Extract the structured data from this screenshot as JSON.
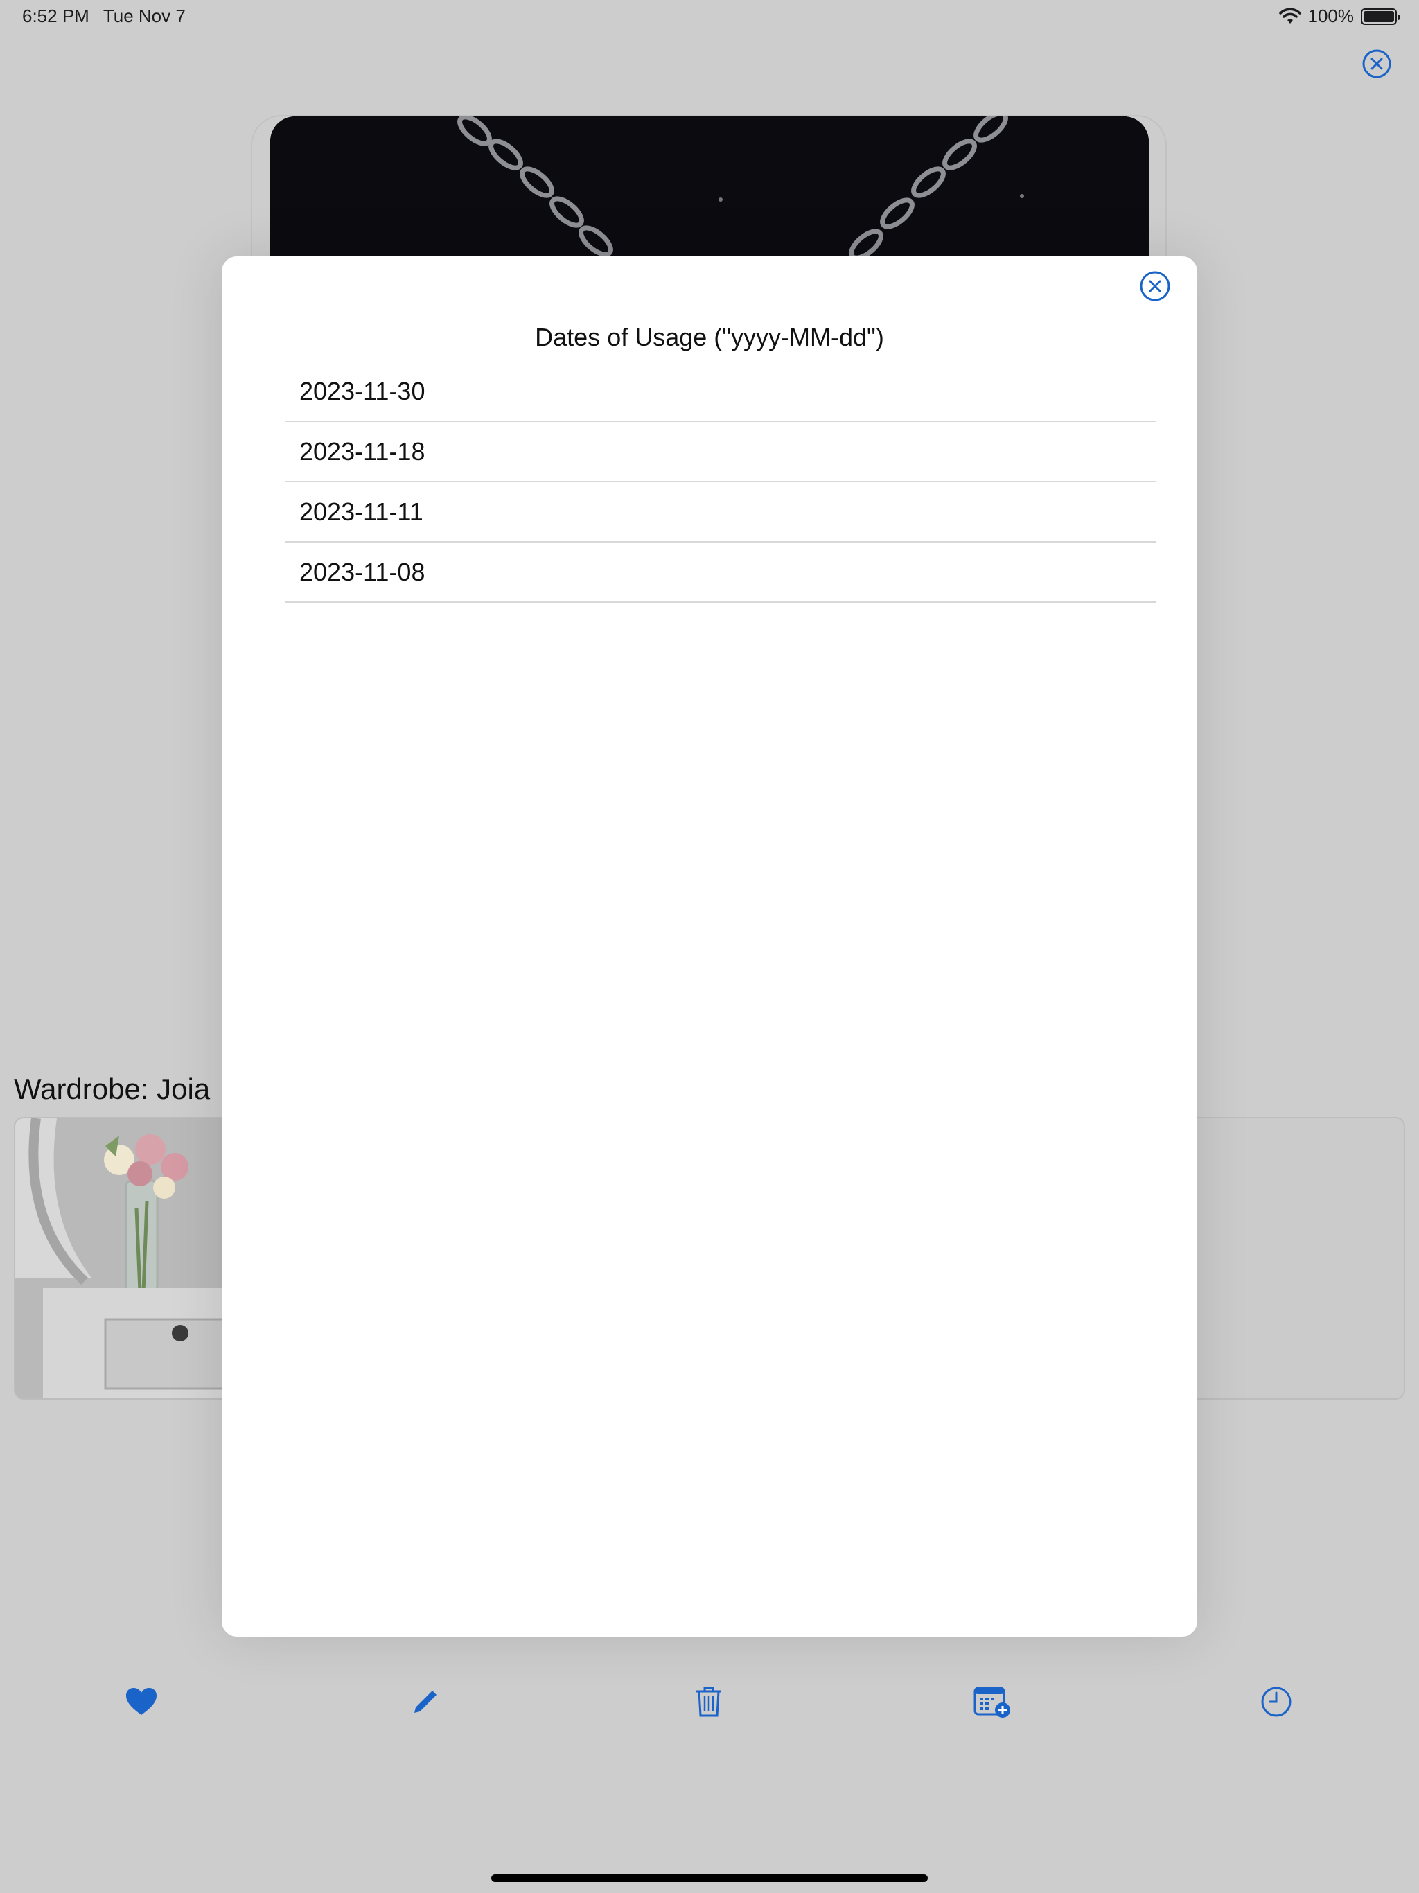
{
  "status_bar": {
    "time": "6:52 PM",
    "date": "Tue Nov 7",
    "battery": "100%",
    "battery_level": 1.0,
    "icons": [
      "wifi-icon",
      "battery-icon"
    ]
  },
  "wardrobe": {
    "title": "Wardrobe: Joia"
  },
  "modal": {
    "title": "Dates of Usage (\"yyyy-MM-dd\")",
    "dates": [
      "2023-11-30",
      "2023-11-18",
      "2023-11-11",
      "2023-11-08"
    ]
  },
  "toolbar": {
    "items": [
      {
        "icon": "heart-icon"
      },
      {
        "icon": "pencil-icon"
      },
      {
        "icon": "trash-icon"
      },
      {
        "icon": "calendar-add-icon"
      },
      {
        "icon": "clock-icon"
      }
    ]
  },
  "colors": {
    "accent": "#1a63c8",
    "dim_background": "#cdcdcd",
    "modal_background": "#ffffff",
    "separator": "#d8d8d8"
  }
}
